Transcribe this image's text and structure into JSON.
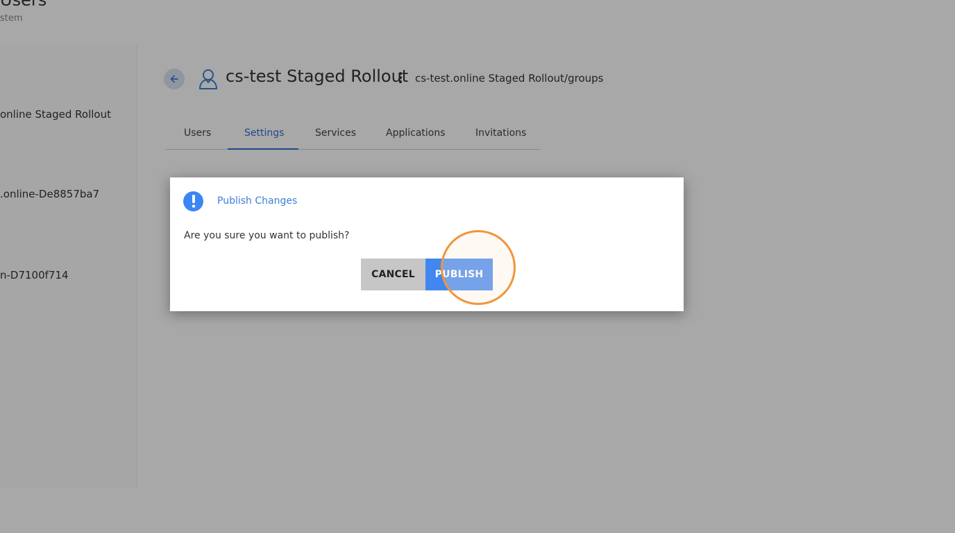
{
  "page": {
    "title": "Users",
    "subtitle": "stem"
  },
  "sidebar": {
    "items": [
      {
        "label": "online Staged Rollout"
      },
      {
        "label": ".online-De8857ba7"
      },
      {
        "label": "n-D7100f714"
      }
    ]
  },
  "group": {
    "title": "cs-test Staged Rollout",
    "path": "cs-test.online Staged Rollout/groups",
    "icons": {
      "back": "arrow-left-icon",
      "group": "user-outline-icon",
      "menu": "kebab-icon"
    }
  },
  "tabs": {
    "active_index": 1,
    "items": [
      {
        "label": "Users"
      },
      {
        "label": "Settings"
      },
      {
        "label": "Services"
      },
      {
        "label": "Applications"
      },
      {
        "label": "Invitations"
      }
    ]
  },
  "dialog": {
    "title": "Publish Changes",
    "message": "Are you sure you want to publish?",
    "cancel_label": "CANCEL",
    "publish_label": "PUBLISH",
    "icon": "exclamation-icon"
  },
  "colors": {
    "accent": "#3b86f0",
    "publish_button": "#4287f0",
    "cancel_button": "#c6c6c6",
    "click_ring": "#f0953a"
  }
}
